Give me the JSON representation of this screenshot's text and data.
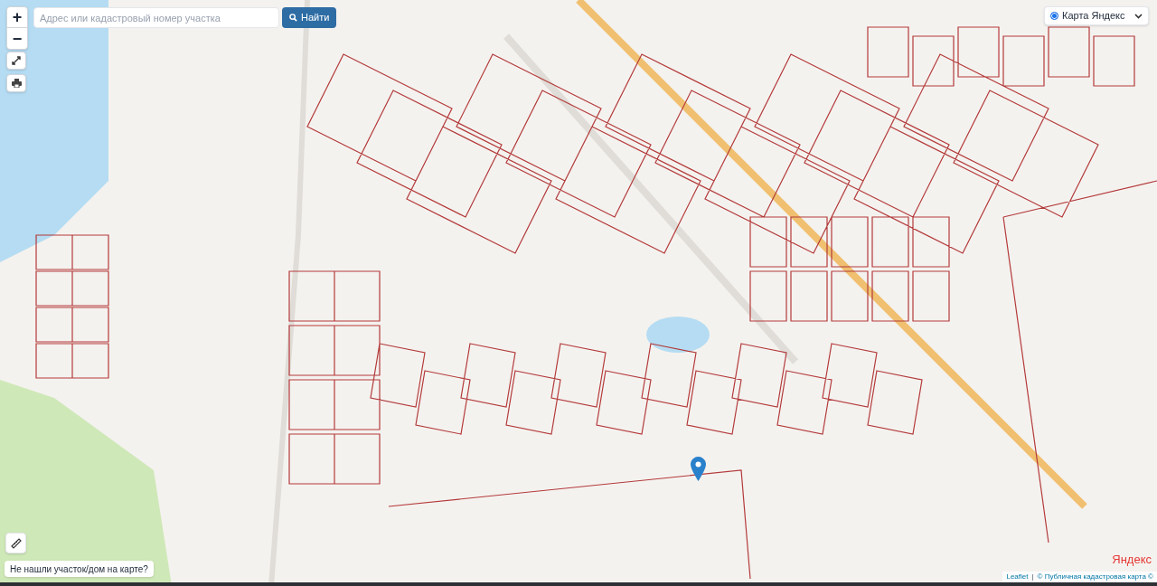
{
  "search": {
    "placeholder": "Адрес или кадастровый номер участка",
    "button": "Найти"
  },
  "zoom": {
    "in": "+",
    "out": "−"
  },
  "layer_select": {
    "value": "Карта Яндекс",
    "selected": true
  },
  "report_button": "Не нашли участок/дом на карте?",
  "map_logo": "Яндекс",
  "attribution": {
    "link": "Leaflet",
    "separator": "|",
    "text": "© Публичная кадастровая карта ©"
  }
}
